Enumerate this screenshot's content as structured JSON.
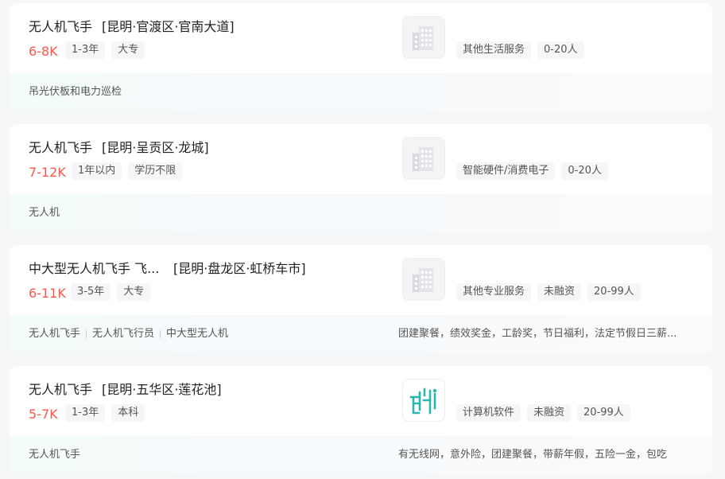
{
  "jobs": [
    {
      "title": "无人机飞手",
      "location": "[昆明·官渡区·官南大道]",
      "salary": "6-8K",
      "tags": [
        "1-3年",
        "大专"
      ],
      "company_tags": [
        "其他生活服务",
        "0-20人"
      ],
      "logo_icon": "building-icon",
      "skills": [
        "吊光伏板和电力巡检"
      ],
      "welfare": ""
    },
    {
      "title": "无人机飞手",
      "location": "[昆明·呈贡区·龙城]",
      "salary": "7-12K",
      "tags": [
        "1年以内",
        "学历不限"
      ],
      "company_tags": [
        "智能硬件/消费电子",
        "0-20人"
      ],
      "logo_icon": "building-icon",
      "skills": [
        "无人机"
      ],
      "welfare": ""
    },
    {
      "title": "中大型无人机飞手 飞...",
      "location": "[昆明·盘龙区·虹桥车市]",
      "salary": "6-11K",
      "tags": [
        "3-5年",
        "大专"
      ],
      "company_tags": [
        "其他专业服务",
        "未融资",
        "20-99人"
      ],
      "logo_icon": "building-icon",
      "skills": [
        "无人机飞手",
        "无人机飞行员",
        "中大型无人机"
      ],
      "welfare": "团建聚餐，绩效奖金，工龄奖，节日福利，法定节假日三薪..."
    },
    {
      "title": "无人机飞手",
      "location": "[昆明·五华区·莲花池]",
      "salary": "5-7K",
      "tags": [
        "1-3年",
        "本科"
      ],
      "company_tags": [
        "计算机软件",
        "未融资",
        "20-99人"
      ],
      "logo_icon": "company-logo-icon",
      "skills": [
        "无人机飞手"
      ],
      "welfare": "有无线网，意外险，团建聚餐，带薪年假，五险一金，包吃"
    }
  ],
  "colors": {
    "salary": "#fe574a",
    "accent": "#2bb5b1"
  }
}
